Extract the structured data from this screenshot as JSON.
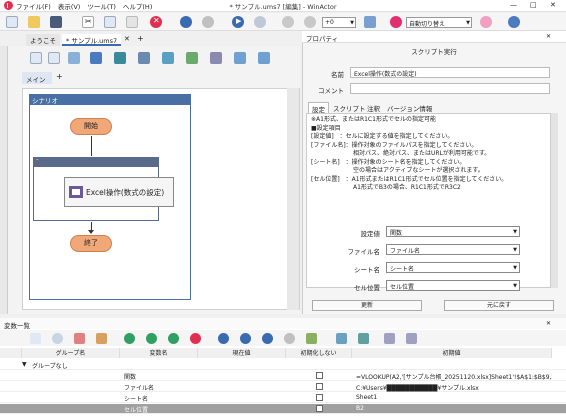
{
  "window": {
    "title": "* サンプル.ums7 [編集] - WinActor",
    "menu": [
      "ファイル(F)",
      "表示(V)",
      "ツール(T)",
      "ヘルプ(H)"
    ],
    "window_controls": [
      "—",
      "□",
      "✕"
    ]
  },
  "toolbar": {
    "speed_value": "+0",
    "auto_switch_label": "自動切り替え"
  },
  "editor": {
    "tabs": [
      "ようこそ",
      "* サンプル.ums7"
    ],
    "sub_tab": "メイン",
    "scenario_label": "シナリオ",
    "start_label": "開始",
    "end_label": "終了",
    "node_label": "Excel操作(数式の設定)"
  },
  "properties": {
    "panel_title": "プロパティ",
    "header": "スクリプト実行",
    "name_label": "名前",
    "name_value": "Excel操作(数式の設定)",
    "comment_label": "コメント",
    "comment_value": "",
    "tabs": [
      "設定",
      "スクリプト",
      "注釈",
      "バージョン情報"
    ],
    "description_lines": [
      "※A1形式、またはR1C1形式でセルの指定可能",
      "",
      "■設定項目",
      "[設定値]　：セルに設定する値を指定してください。",
      "[ファイル名]：操作対象のファイルパスを指定してください。",
      "　　　　　　　相対パス、絶対パス、またはURLが利用可能です。",
      "[シート名]　：操作対象のシート名を指定してください。",
      "　　　　　　　空の場合はアクティブなシートが選択されます。",
      "[セル位置]　：A1形式またはR1C1形式でセル位置を指定してください。",
      "　　　　　　　A1形式でB3の場合、R1C1形式でR3C2"
    ],
    "settings": [
      {
        "label": "設定値",
        "value": "関数"
      },
      {
        "label": "ファイル名",
        "value": "ファイル名"
      },
      {
        "label": "シート名",
        "value": "シート名"
      },
      {
        "label": "セル位置",
        "value": "セル位置"
      }
    ],
    "update_button": "更新",
    "revert_button": "元に戻す"
  },
  "variables": {
    "panel_title": "変数一覧",
    "columns": [
      "グループ名",
      "変数名",
      "現在値",
      "初期化しない",
      "初期値"
    ],
    "group_row": "グループなし",
    "rows": [
      {
        "name": "関数",
        "current": "",
        "init_value": "=VLOOKUP(A2,'[サンプル台帳_20251120.xlsx]Sheet1'!$A$1:$B$9,2,FALSE)"
      },
      {
        "name": "ファイル名",
        "current": "",
        "init_value": "C:¥Users¥███████████¥サンプル.xlsx"
      },
      {
        "name": "シート名",
        "current": "",
        "init_value": "Sheet1"
      },
      {
        "name": "セル位置",
        "current": "",
        "init_value": "B2"
      }
    ]
  }
}
